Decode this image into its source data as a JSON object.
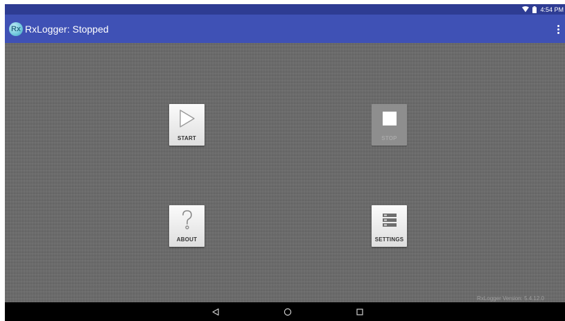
{
  "status_bar": {
    "time": "4:54 PM",
    "icons": [
      "wifi-icon",
      "battery-icon"
    ]
  },
  "app_bar": {
    "logo_text": "Rx",
    "title": "RxLogger: Stopped"
  },
  "buttons": {
    "start": {
      "label": "START",
      "icon": "play-icon",
      "enabled": true
    },
    "stop": {
      "label": "STOP",
      "icon": "stop-icon",
      "enabled": false
    },
    "about": {
      "label": "ABOUT",
      "icon": "question-mark-icon",
      "enabled": true
    },
    "settings": {
      "label": "SETTINGS",
      "icon": "settings-list-icon",
      "enabled": true
    }
  },
  "footer": {
    "version": "RxLogger Version: 5.4.12.0"
  },
  "nav_bar": {
    "buttons": [
      "back-icon",
      "home-icon",
      "recents-icon"
    ]
  },
  "colors": {
    "status_bar": "#2e3c93",
    "app_bar": "#3f51b5",
    "background": "#6b6b6b",
    "nav_bar": "#000000"
  }
}
